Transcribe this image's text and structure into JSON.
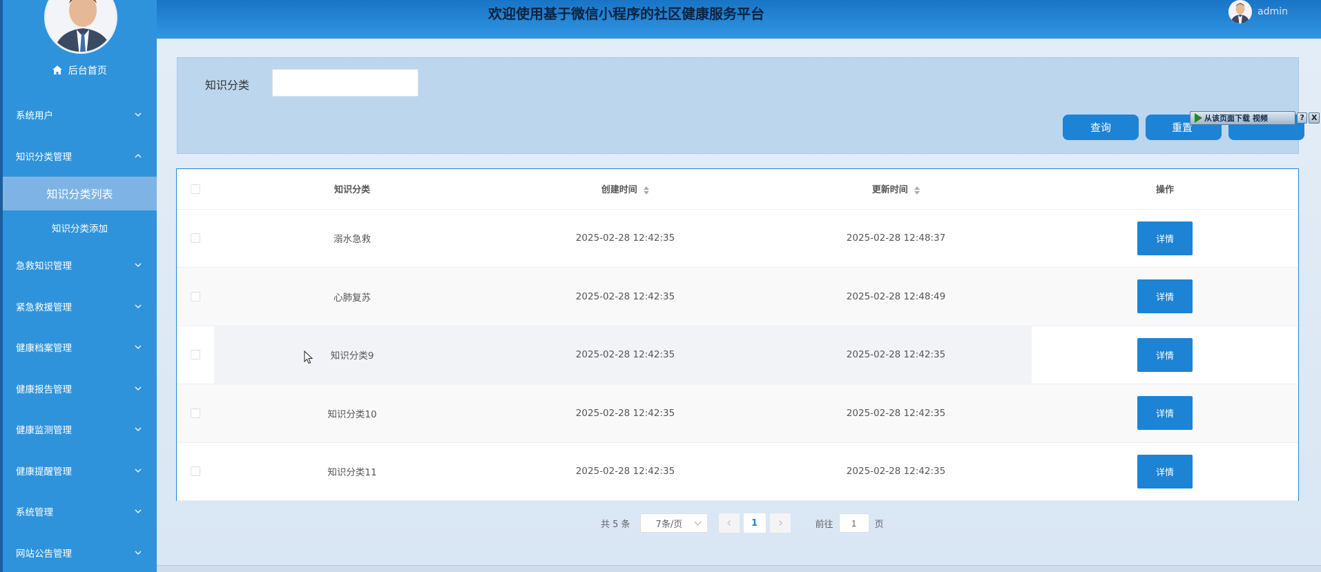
{
  "app": {
    "title": "欢迎使用基于微信小程序的社区健康服务平台",
    "username": "admin"
  },
  "sidebar": {
    "home_label": "后台首页",
    "items": [
      {
        "label": "系统用户"
      },
      {
        "label": "知识分类管理"
      },
      {
        "label": "急救知识管理"
      },
      {
        "label": "紧急救援管理"
      },
      {
        "label": "健康档案管理"
      },
      {
        "label": "健康报告管理"
      },
      {
        "label": "健康监测管理"
      },
      {
        "label": "健康提醒管理"
      },
      {
        "label": "系统管理"
      },
      {
        "label": "网站公告管理"
      }
    ],
    "submenu": {
      "active_label": "知识分类列表",
      "add_label": "知识分类添加"
    }
  },
  "search": {
    "field_label": "知识分类",
    "value": "",
    "query_button": "查询",
    "reset_button": "重置"
  },
  "download_bar": {
    "label": "从该页面下载 视频",
    "help": "?",
    "close": "X"
  },
  "table": {
    "headers": [
      "知识分类",
      "创建时间",
      "更新时间",
      "操作"
    ],
    "rows": [
      {
        "category": "溺水急救",
        "created": "2025-02-28 12:42:35",
        "updated": "2025-02-28 12:48:37",
        "action": "详情"
      },
      {
        "category": "心肺复苏",
        "created": "2025-02-28 12:42:35",
        "updated": "2025-02-28 12:48:49",
        "action": "详情"
      },
      {
        "category": "知识分类9",
        "created": "2025-02-28 12:42:35",
        "updated": "2025-02-28 12:42:35",
        "action": "详情"
      },
      {
        "category": "知识分类10",
        "created": "2025-02-28 12:42:35",
        "updated": "2025-02-28 12:42:35",
        "action": "详情"
      },
      {
        "category": "知识分类11",
        "created": "2025-02-28 12:42:35",
        "updated": "2025-02-28 12:42:35",
        "action": "详情"
      }
    ]
  },
  "pagination": {
    "total": "共 5 条",
    "page_size": "7条/页",
    "current_page": "1",
    "goto_label": "前往",
    "goto_value": "1",
    "page_unit": "页"
  },
  "colors": {
    "sidebar": "#2f93dc",
    "accent": "#1d83d4",
    "topbar": "#1974c6"
  }
}
